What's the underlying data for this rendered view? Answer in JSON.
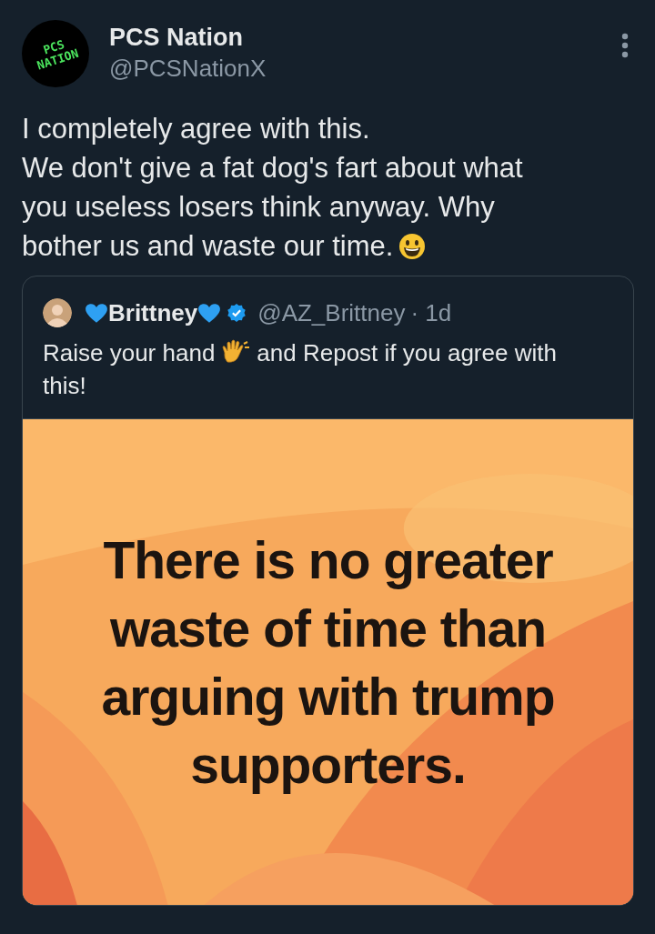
{
  "post": {
    "author": {
      "name": "PCS Nation",
      "handle": "@PCSNationX",
      "logo_text": [
        "PCS",
        "NATION"
      ]
    },
    "text_lines": [
      "I completely agree with this.",
      "We don't give a fat dog's fart about what",
      "you useless losers think anyway. Why",
      "bother us and waste our time."
    ],
    "quote": {
      "author": {
        "name": "Brittney",
        "handle": "@AZ_Brittney",
        "verified": true,
        "time": "· 1d"
      },
      "text_before": "Raise your hand",
      "text_after": "and Repost if you agree with",
      "text_next_line": "this!",
      "image": {
        "kind": "picture",
        "lines": [
          "There is no greater",
          "waste of time than",
          "arguing with trump",
          "supporters."
        ]
      }
    }
  }
}
